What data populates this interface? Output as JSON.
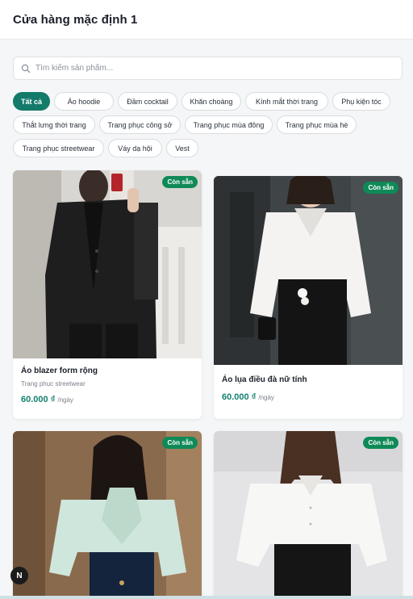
{
  "header": {
    "title": "Cửa hàng mặc định 1"
  },
  "search": {
    "placeholder": "Tìm kiếm sản phẩm..."
  },
  "filters": {
    "rows": [
      [
        "Tất cả",
        "Áo hoodie",
        "Đầm cocktail",
        "Khăn choàng",
        "Kính mắt thời trang",
        "Phụ kiện tóc"
      ],
      [
        "Thắt lưng thời trang",
        "Trang phục công sở",
        "Trang phục mùa đông",
        "Trang phục mùa hè"
      ],
      [
        "Trang phục streetwear",
        "Váy dạ hội",
        "Vest"
      ]
    ],
    "active": "Tất cả"
  },
  "products": [
    {
      "name": "Áo blazer form rộng",
      "category": "Trang phục streetwear",
      "price": "60.000 ₫",
      "unit": "/ngày",
      "badge": "Còn sẵn",
      "image": "black-blazer-photo"
    },
    {
      "name": "Áo lụa điều đà nữ tính",
      "category": "",
      "price": "60.000 ₫",
      "unit": "/ngày",
      "badge": "Còn sẵn",
      "image": "white-silk-blouse-photo"
    },
    {
      "name": "",
      "category": "",
      "price": "",
      "unit": "",
      "badge": "Còn sẵn",
      "image": "mint-bow-blouse-photo"
    },
    {
      "name": "",
      "category": "",
      "price": "",
      "unit": "",
      "badge": "Còn sẵn",
      "image": "white-shirt-photo"
    }
  ],
  "fab": {
    "label": "N"
  },
  "colors": {
    "accent": "#147a6a",
    "badge": "#0f8a57"
  }
}
